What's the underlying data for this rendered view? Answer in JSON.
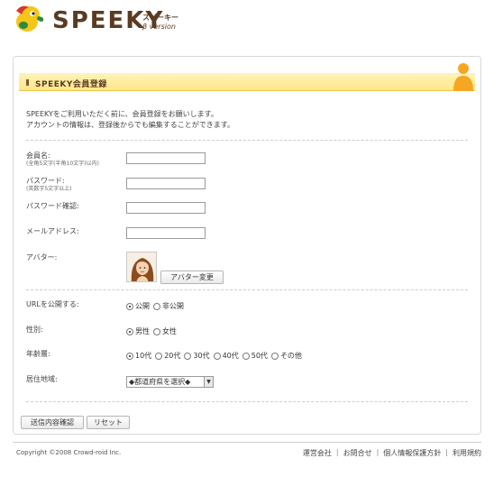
{
  "header": {
    "logo_text": "SPEEKY",
    "logo_kana": "スピーキー",
    "logo_version": "β version"
  },
  "card": {
    "title": "SPEEKY会員登録",
    "intro_line1": "SPEEKYをご利用いただく前に、会員登録をお願いします。",
    "intro_line2": "アカウントの情報は、登録後からでも編集することができます。"
  },
  "form": {
    "member_name_label": "会員名:",
    "member_name_hint": "(全角5文字(半角10文字)以内)",
    "member_name_value": "",
    "password_label": "パスワード:",
    "password_hint": "(英数字5文字以上)",
    "password_value": "",
    "password_confirm_label": "パスワード確認:",
    "password_confirm_value": "",
    "email_label": "メールアドレス:",
    "email_value": "",
    "avatar_label": "アバター:",
    "avatar_change_button": "アバター変更",
    "url_public_label": "URLを公開する:",
    "url_public_options": [
      "公開",
      "非公開"
    ],
    "url_public_selected": "公開",
    "gender_label": "性別:",
    "gender_options": [
      "男性",
      "女性"
    ],
    "gender_selected": "男性",
    "age_label": "年齢層:",
    "age_options": [
      "10代",
      "20代",
      "30代",
      "40代",
      "50代",
      "その他"
    ],
    "age_selected": "10代",
    "region_label": "居住地域:",
    "region_selected": "◆都道府県を選択◆",
    "submit_button": "送信内容確認",
    "reset_button": "リセット"
  },
  "footer": {
    "copyright": "Copyright ©2008 Crowd-roid Inc.",
    "links": [
      "運営会社",
      "お問合せ",
      "個人情報保護方針",
      "利用規約"
    ]
  },
  "colors": {
    "brand_brown": "#5a3b22",
    "title_bar_yellow": "#fde88a",
    "accent_orange": "#f5a623"
  }
}
